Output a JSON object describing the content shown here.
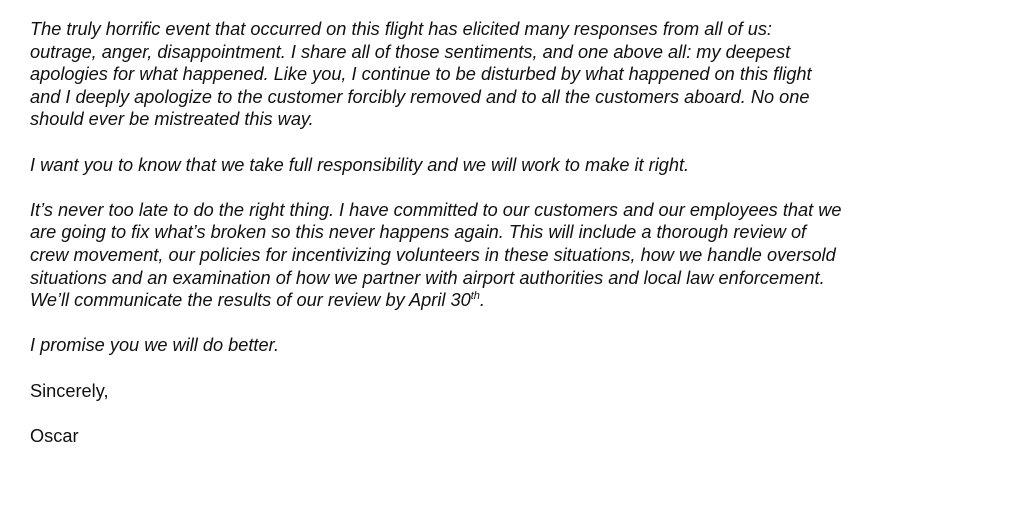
{
  "letter": {
    "p1": {
      "l1": "The truly horrific event that occurred on this flight has elicited many responses from all of us:",
      "l2": "outrage, anger, disappointment.  I share all of those sentiments, and one above all: my deepest",
      "l3": "apologies for what happened. Like you, I continue to be disturbed by what happened on this flight",
      "l4": "and I deeply apologize to the customer forcibly removed and to all the customers aboard.   No one",
      "l5": "should ever be mistreated this way."
    },
    "p2": {
      "l1": "I want you to know that we take full responsibility and we will work to make it right."
    },
    "p3": {
      "l1": "It’s never too late to do the right thing. I have committed to our customers and our employees that we",
      "l2": "are going to fix what’s broken so this never happens again. This will include a thorough review of",
      "l3": "crew movement, our policies for incentivizing volunteers in these situations, how we handle oversold",
      "l4": "situations and an examination of how we partner with airport authorities and local law enforcement.",
      "l5_main": "We’ll communicate the results of our review by April 30",
      "l5_sup": "th",
      "l5_end": "."
    },
    "p4": {
      "l1": "I promise you we will do better."
    },
    "closing": "Sincerely,",
    "signature": "Oscar"
  }
}
